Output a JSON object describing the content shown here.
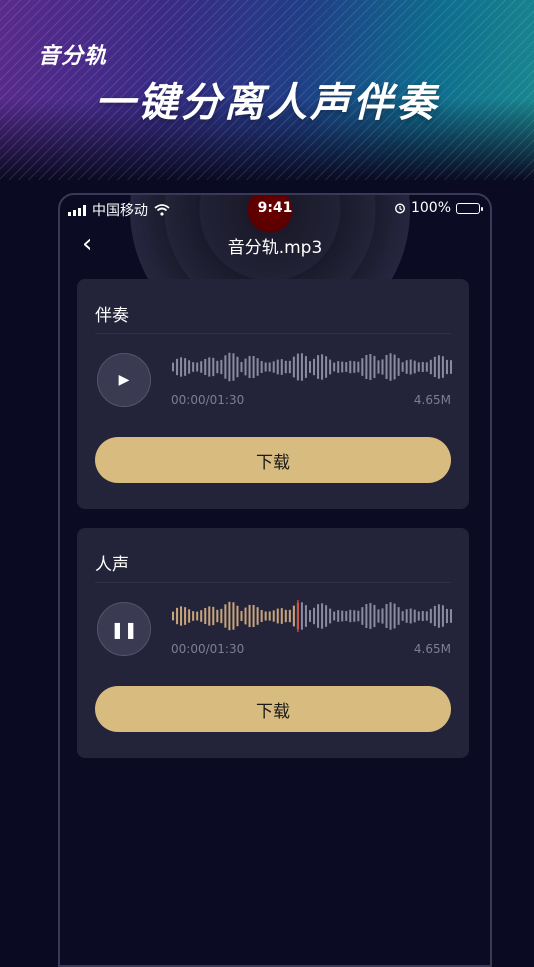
{
  "banner": {
    "app_tag": "音分轨",
    "headline": "一键分离人声伴奏"
  },
  "status_bar": {
    "carrier": "中国移动",
    "time": "9:41",
    "battery": "100%"
  },
  "nav": {
    "back_glyph": "‹",
    "title": "音分轨.mp3"
  },
  "tracks": [
    {
      "label": "伴奏",
      "state": "paused",
      "control_glyph": "▶",
      "time": "00:00/01:30",
      "size": "4.65M",
      "progress": 0,
      "download_label": "下载"
    },
    {
      "label": "人声",
      "state": "playing",
      "control_glyph": "❚❚",
      "time": "00:00/01:30",
      "size": "4.65M",
      "progress": 0.45,
      "download_label": "下载"
    }
  ],
  "colors": {
    "accent": "#d8bb7e",
    "wave_idle": "#8a8aa0",
    "wave_played": "#c9a57a",
    "playhead": "#e03a3a",
    "card": "#23233a",
    "background": "#0a0a22"
  }
}
